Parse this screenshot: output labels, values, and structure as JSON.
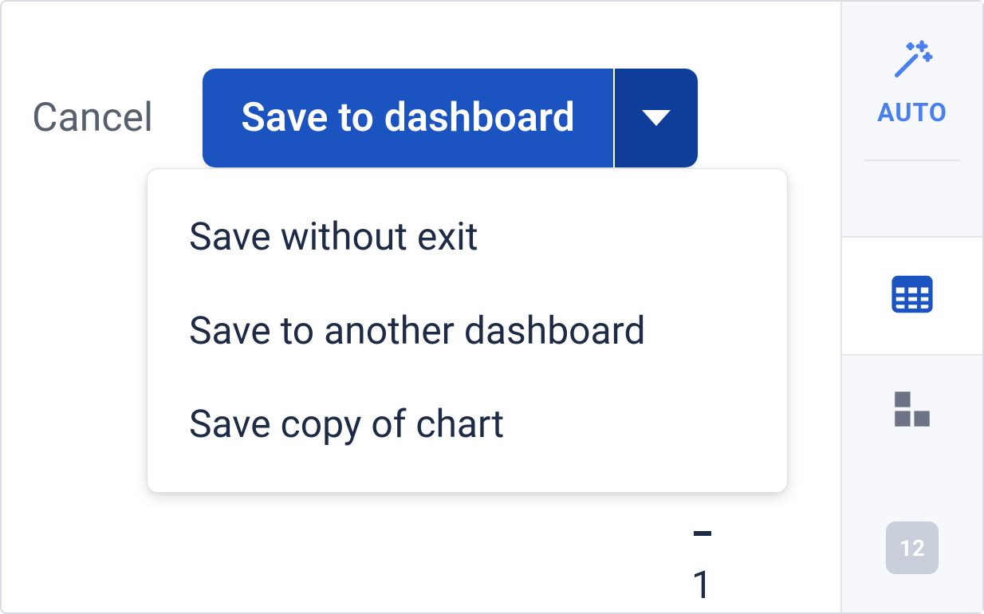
{
  "toolbar": {
    "cancel_label": "Cancel",
    "save_label": "Save to dashboard"
  },
  "dropdown": {
    "items": [
      {
        "label": "Save without exit"
      },
      {
        "label": "Save to another dashboard"
      },
      {
        "label": "Save copy of chart"
      }
    ]
  },
  "right_rail": {
    "auto_label": "AUTO",
    "number_tile": "12"
  },
  "background": {
    "partial_number": "1"
  }
}
